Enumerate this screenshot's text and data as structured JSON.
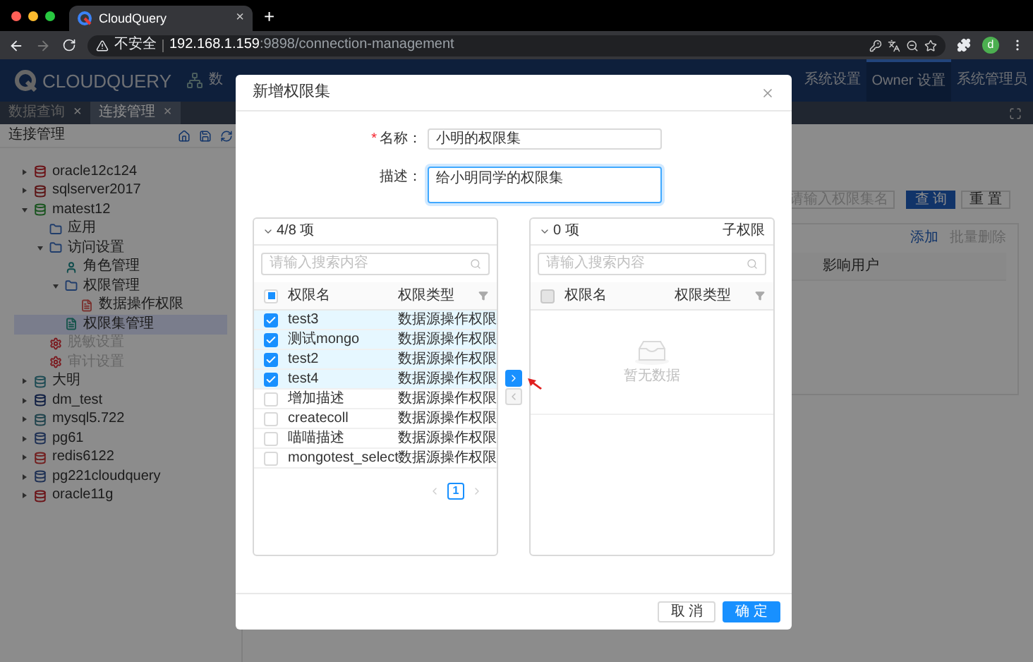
{
  "browser": {
    "tabs": [
      {
        "title": "CloudQuery",
        "close": "×",
        "selected": true
      }
    ],
    "new_tab": "+",
    "security": "不安全",
    "url_host": "192.168.1.159",
    "url_path": ":9898/connection-management",
    "profile": "d"
  },
  "header": {
    "logo": "CLOUDQUERY",
    "left_nav": {
      "label": "数"
    },
    "nav": [
      {
        "label": "系统设置",
        "selected": false
      },
      {
        "label": "Owner 设置",
        "selected": true
      },
      {
        "label": "系统管理员",
        "selected": false
      }
    ]
  },
  "page_tabs": [
    {
      "label": "数据查询",
      "close": "×",
      "selected": false
    },
    {
      "label": "连接管理",
      "close": "×",
      "selected": true
    }
  ],
  "sidebar": {
    "title": "连接管理",
    "tree": [
      {
        "label": "oracle12c124",
        "kind": "oracle",
        "expanded": false,
        "selected": false,
        "disabled": false
      },
      {
        "label": "sqlserver2017",
        "kind": "sqlserver",
        "expanded": false,
        "selected": false,
        "disabled": false
      },
      {
        "label": "matest12",
        "kind": "mongodb",
        "expanded": true,
        "selected": false,
        "disabled": false,
        "children": [
          {
            "label": "应用",
            "kind": "folder",
            "selected": false,
            "disabled": false
          },
          {
            "label": "访问设置",
            "kind": "folder",
            "expanded": true,
            "selected": false,
            "disabled": false,
            "children": [
              {
                "label": "角色管理",
                "kind": "role",
                "selected": false,
                "disabled": false
              },
              {
                "label": "权限管理",
                "kind": "folder",
                "expanded": true,
                "selected": false,
                "disabled": false,
                "children": [
                  {
                    "label": "数据操作权限",
                    "kind": "permission",
                    "selected": false,
                    "disabled": false
                  }
                ]
              },
              {
                "label": "权限集管理",
                "kind": "permission-set",
                "selected": true,
                "disabled": false
              }
            ]
          },
          {
            "label": "脱敏设置",
            "kind": "gear",
            "selected": false,
            "disabled": true
          },
          {
            "label": "审计设置",
            "kind": "gear",
            "selected": false,
            "disabled": true
          }
        ]
      },
      {
        "label": "大明",
        "kind": "db",
        "expanded": false,
        "selected": false,
        "disabled": false
      },
      {
        "label": "dm_test",
        "kind": "dm",
        "expanded": false,
        "selected": false,
        "disabled": false
      },
      {
        "label": "mysql5.722",
        "kind": "mysql",
        "expanded": false,
        "selected": false,
        "disabled": false
      },
      {
        "label": "pg61",
        "kind": "postgres",
        "expanded": false,
        "selected": false,
        "disabled": false
      },
      {
        "label": "redis6122",
        "kind": "redis",
        "expanded": false,
        "selected": false,
        "disabled": false
      },
      {
        "label": "pg221cloudquery",
        "kind": "postgres",
        "expanded": false,
        "selected": false,
        "disabled": false
      },
      {
        "label": "oracle11g",
        "kind": "oracle",
        "expanded": false,
        "selected": false,
        "disabled": false
      }
    ]
  },
  "main": {
    "search": {
      "placeholder": "请输入权限集名"
    },
    "buttons": [
      {
        "label": "查 询",
        "kind": "primary"
      },
      {
        "label": "重 置",
        "kind": "default"
      }
    ],
    "actions": [
      {
        "label": "添加",
        "disabled": false
      },
      {
        "label": "批量删除",
        "disabled": true
      }
    ],
    "table": {
      "columns": [
        "影响用户"
      ]
    }
  },
  "modal": {
    "title": "新增权限集",
    "fields": [
      {
        "required_mark": "*",
        "label": "名称：",
        "kind": "input",
        "value": "小明的权限集",
        "focused": false
      },
      {
        "label": "描述：",
        "kind": "textarea",
        "value": "给小明同学的权限集",
        "focused": true
      }
    ],
    "transfer": {
      "left": {
        "count": "4/8 项",
        "search_placeholder": "请输入搜索内容",
        "columns": [
          "权限名",
          "权限类型"
        ],
        "header_checkbox": {
          "indeterminate": true
        },
        "rows": [
          {
            "name": "test3",
            "type": "数据源操作权限",
            "checked": true
          },
          {
            "name": "测试mongo",
            "type": "数据源操作权限",
            "checked": true
          },
          {
            "name": "test2",
            "type": "数据源操作权限",
            "checked": true
          },
          {
            "name": "test4",
            "type": "数据源操作权限",
            "checked": true
          },
          {
            "name": "增加描述",
            "type": "数据源操作权限",
            "checked": false
          },
          {
            "name": "createcoll",
            "type": "数据源操作权限",
            "checked": false
          },
          {
            "name": "喵喵描述",
            "type": "数据源操作权限",
            "checked": false
          },
          {
            "name": "mongotest_select",
            "type": "数据源操作权限",
            "checked": false
          }
        ],
        "pagination": {
          "page": "1"
        }
      },
      "right": {
        "count": "0 项",
        "title": "子权限",
        "search_placeholder": "请输入搜索内容",
        "columns": [
          "权限名",
          "权限类型"
        ],
        "header_checkbox": {
          "disabled": true
        },
        "empty": "暂无数据"
      },
      "move_buttons": [
        {
          "kind": "next",
          "disabled": false
        },
        {
          "kind": "prev",
          "disabled": true
        }
      ]
    },
    "buttons": [
      {
        "label": "取 消",
        "kind": "default"
      },
      {
        "label": "确 定",
        "kind": "primary"
      }
    ]
  }
}
